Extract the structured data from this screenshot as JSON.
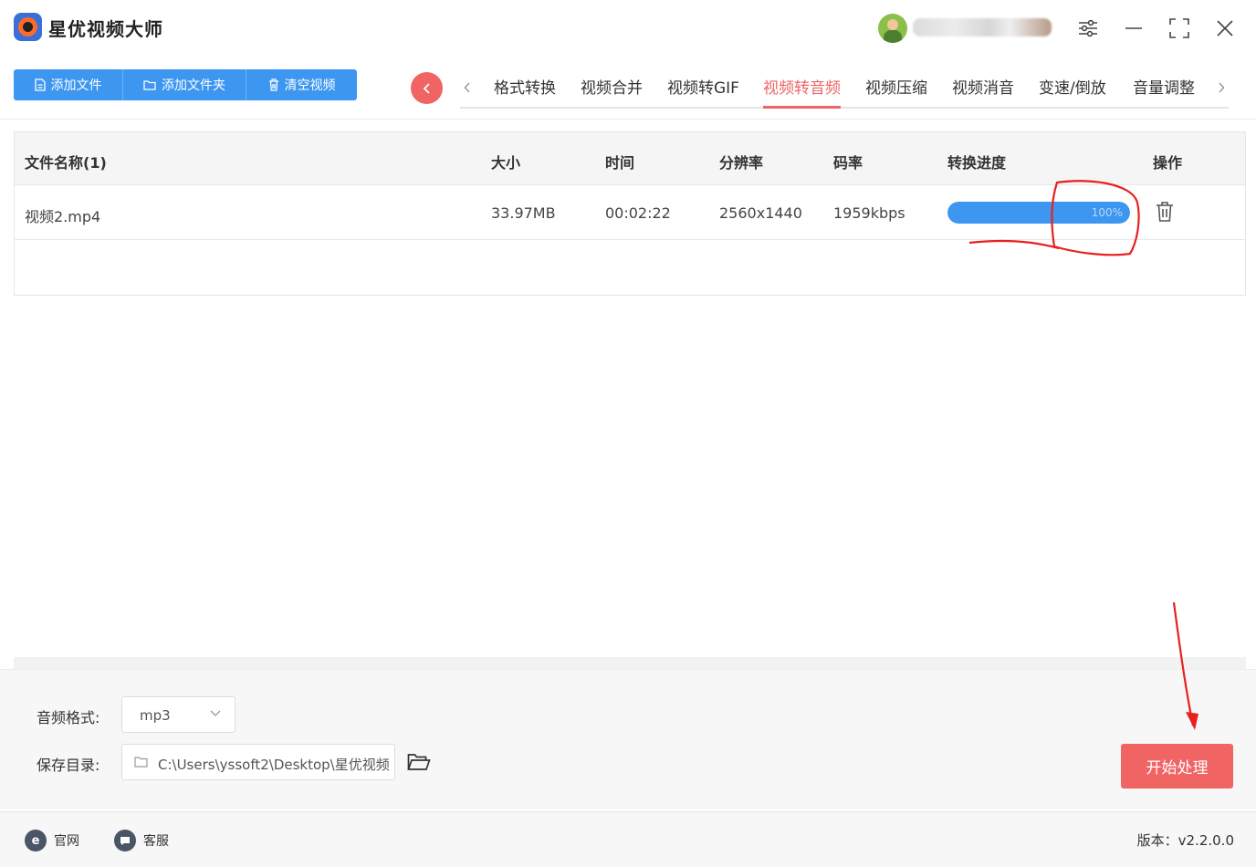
{
  "app": {
    "title": "星优视频大师"
  },
  "toolbar": {
    "add_file": "添加文件",
    "add_folder": "添加文件夹",
    "clear_videos": "清空视频"
  },
  "tabs": [
    {
      "label": "格式转换",
      "active": false
    },
    {
      "label": "视频合并",
      "active": false
    },
    {
      "label": "视频转GIF",
      "active": false
    },
    {
      "label": "视频转音频",
      "active": true
    },
    {
      "label": "视频压缩",
      "active": false
    },
    {
      "label": "视频消音",
      "active": false
    },
    {
      "label": "变速/倒放",
      "active": false
    },
    {
      "label": "音量调整",
      "active": false
    }
  ],
  "table": {
    "headers": {
      "name": "文件名称(1)",
      "size": "大小",
      "time": "时间",
      "resolution": "分辨率",
      "bitrate": "码率",
      "progress": "转换进度",
      "actions": "操作"
    },
    "rows": [
      {
        "name": "视频2.mp4",
        "size": "33.97MB",
        "time": "00:02:22",
        "resolution": "2560x1440",
        "bitrate": "1959kbps",
        "progress_label": "100%",
        "progress_value": 1.0
      }
    ]
  },
  "settings": {
    "audio_format_label": "音频格式:",
    "audio_format_value": "mp3",
    "save_dir_label": "保存目录:",
    "save_dir_value": "C:\\Users\\yssoft2\\Desktop\\星优视频"
  },
  "start_button": "开始处理",
  "footer": {
    "website": "官网",
    "support": "客服",
    "version": "版本：v2.2.0.0"
  },
  "colors": {
    "accent_blue": "#3d97f0",
    "accent_red": "#f06464",
    "annotation_red": "#e8201f"
  }
}
